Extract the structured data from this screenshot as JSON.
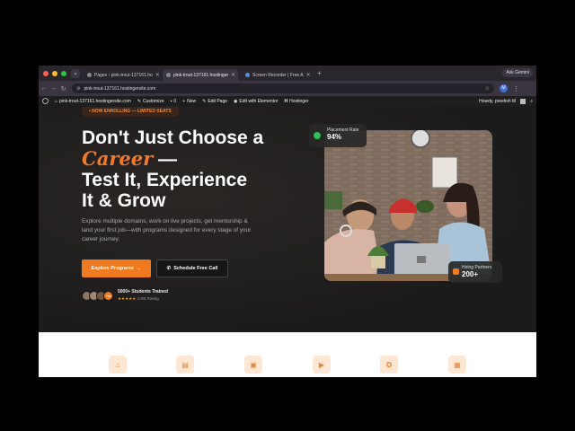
{
  "browser": {
    "tabs": [
      {
        "label": "Pages ‹ pink-trout-137161.ho",
        "active": false
      },
      {
        "label": "pink-trout-137161.hostinger",
        "active": true
      },
      {
        "label": "Screen Recorder | Free A",
        "active": false
      }
    ],
    "ask_gemini": "Ask Gemini",
    "url": "pink-trout-137161.hostingersite.com",
    "profile_initial": "M"
  },
  "wp_bar": {
    "site": "pink-trout-137161.hostingersite.com",
    "customize": "Customize",
    "comments": "0",
    "new": "New",
    "edit_page": "Edit Page",
    "elementor": "Edit with Elementor",
    "hostinger": "Hostinger",
    "howdy": "Howdy, preetish M"
  },
  "hero": {
    "enroll": "• NOW ENROLLING — LIMITED SEATS",
    "headline_1": "Don't Just Choose a",
    "headline_accent": "Career",
    "headline_dash": " —",
    "headline_2": "Test It, Experience",
    "headline_3": "It & Grow",
    "description": "Explore multiple domains, work on live projects, get mentorship & land your first job—with programs designed for every stage of your career journey.",
    "btn_primary": "Explore Programs",
    "btn_secondary": "Schedule Free Call",
    "faces_more": "+5k",
    "students": "5000+ Students Trained",
    "rating": "4.9/5 Rating",
    "stars": "★★★★★"
  },
  "badges": {
    "placement_label": "Placement Rate",
    "placement_value": "94%",
    "hiring_label": "Hiring Partners",
    "hiring_value": "200+"
  },
  "features": {
    "icons": [
      "graduation-cap-icon",
      "certificate-icon",
      "briefcase-icon",
      "video-icon",
      "award-icon",
      "calendar-icon"
    ]
  },
  "colors": {
    "accent": "#f07a1f",
    "dark_bg": "#1c1b1c",
    "success": "#2fbf55"
  }
}
